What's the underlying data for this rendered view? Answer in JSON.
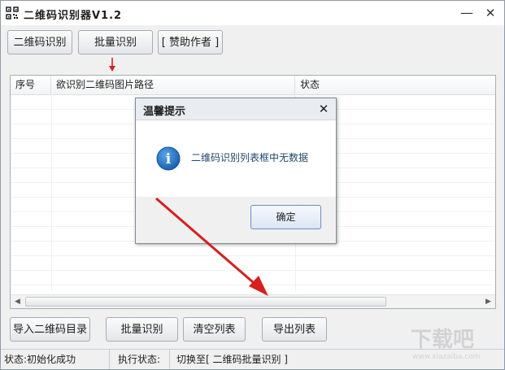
{
  "window": {
    "title": "二维码识别器V1.2",
    "minimize": "—",
    "close": "✕"
  },
  "toolbar": {
    "decode": "二维码识别",
    "batch": "批量识别",
    "donate": "[ 赞助作者 ]"
  },
  "table": {
    "columns": [
      "序号",
      "欲识别二维码图片路径",
      "状态"
    ],
    "rows": []
  },
  "scrollbar": {
    "left_arrow": "◀",
    "right_arrow": "▶"
  },
  "bottom_buttons": {
    "import": "导入二维码目录",
    "batch": "批量识别",
    "clear": "清空列表",
    "export": "导出列表"
  },
  "status": {
    "init": "状态:初始化成功",
    "exec_label": "执行状态:",
    "exec_value": "切换至[ 二维码批量识别 ]"
  },
  "dialog": {
    "title": "温馨提示",
    "close": "✕",
    "message": "二维码识别列表框中无数据",
    "ok": "确定",
    "info_glyph": "i"
  },
  "colors": {
    "arrow": "#d62020",
    "accent": "#1f6fc0"
  },
  "icons": {
    "app": "qr-code-icon",
    "info": "info-icon",
    "pointer": "red-arrow-icon"
  },
  "watermark": {
    "brand": "下载吧",
    "site": "www.xiazaiba.com"
  }
}
